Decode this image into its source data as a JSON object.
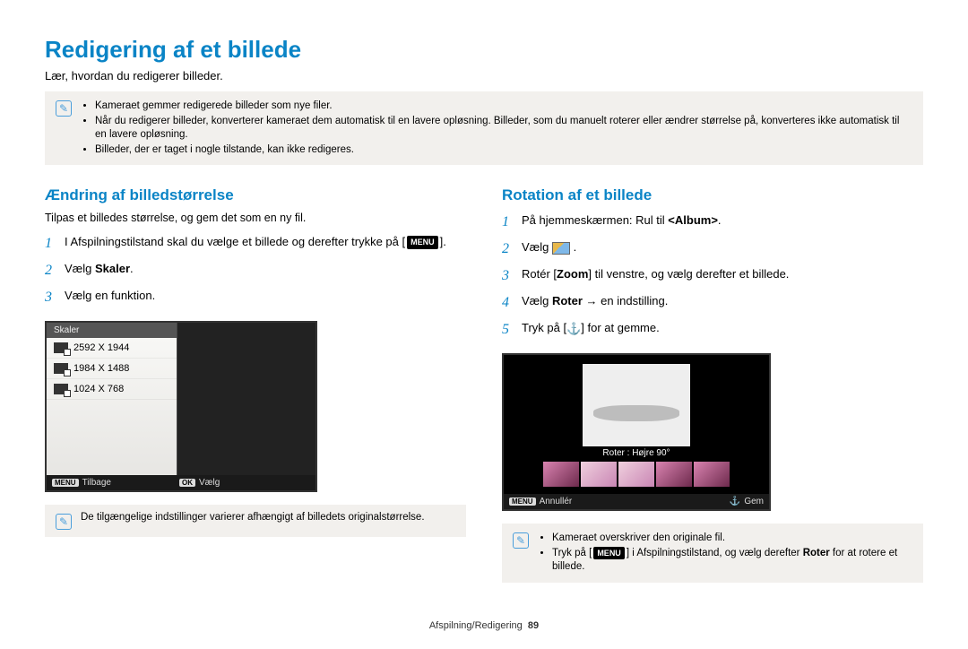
{
  "page_title": "Redigering af et billede",
  "subtitle": "Lær, hvordan du redigerer billeder.",
  "top_note": {
    "items": [
      "Kameraet gemmer redigerede billeder som nye filer.",
      "Når du redigerer billeder, konverterer kameraet dem automatisk til en lavere opløsning. Billeder, som du manuelt roterer eller ændrer størrelse på, konverteres ikke automatisk til en lavere opløsning.",
      "Billeder, der er taget i nogle tilstande, kan ikke redigeres."
    ]
  },
  "left": {
    "heading": "Ændring af billedstørrelse",
    "desc": "Tilpas et billedes størrelse, og gem det som en ny fil.",
    "step1_pre": "I Afspilningstilstand skal du vælge et billede og derefter trykke på [",
    "step1_btn": "MENU",
    "step1_post": "].",
    "step2_pre": "Vælg ",
    "step2_bold": "Skaler",
    "step2_post": ".",
    "step3": "Vælg en funktion.",
    "lcd": {
      "menu_title": "Skaler",
      "items": [
        "2592 X 1944",
        "1984 X 1488",
        "1024 X 768"
      ],
      "back_tag": "MENU",
      "back_text": "Tilbage",
      "ok_tag": "OK",
      "ok_text": "Vælg"
    },
    "note": "De tilgængelige indstillinger varierer afhængigt af billedets originalstørrelse."
  },
  "right": {
    "heading": "Rotation af et billede",
    "step1_pre": "På hjemmeskærmen: Rul til ",
    "step1_bold": "<Album>",
    "step1_post": ".",
    "step2_pre": "Vælg ",
    "step2_post": " .",
    "step3_pre": "Rotér [",
    "step3_bold": "Zoom",
    "step3_post": "] til venstre, og vælg derefter et billede.",
    "step4_pre": "Vælg ",
    "step4_bold": "Roter",
    "step4_post": " → en indstilling.",
    "step5_pre": "Tryk på [",
    "step5_post": "] for at gemme.",
    "lcd": {
      "overlay_text": "Roter : Højre 90°",
      "back_tag": "MENU",
      "back_text": "Annullér",
      "save_text": "Gem"
    },
    "note_items": [
      "Kameraet overskriver den originale fil."
    ],
    "note2_pre": "Tryk på [",
    "note2_btn": "MENU",
    "note2_mid": "] i Afspilningstilstand, og vælg derefter ",
    "note2_bold": "Roter",
    "note2_post": " for at rotere et billede."
  },
  "footer": {
    "section": "Afspilning/Redigering",
    "page": "89"
  }
}
